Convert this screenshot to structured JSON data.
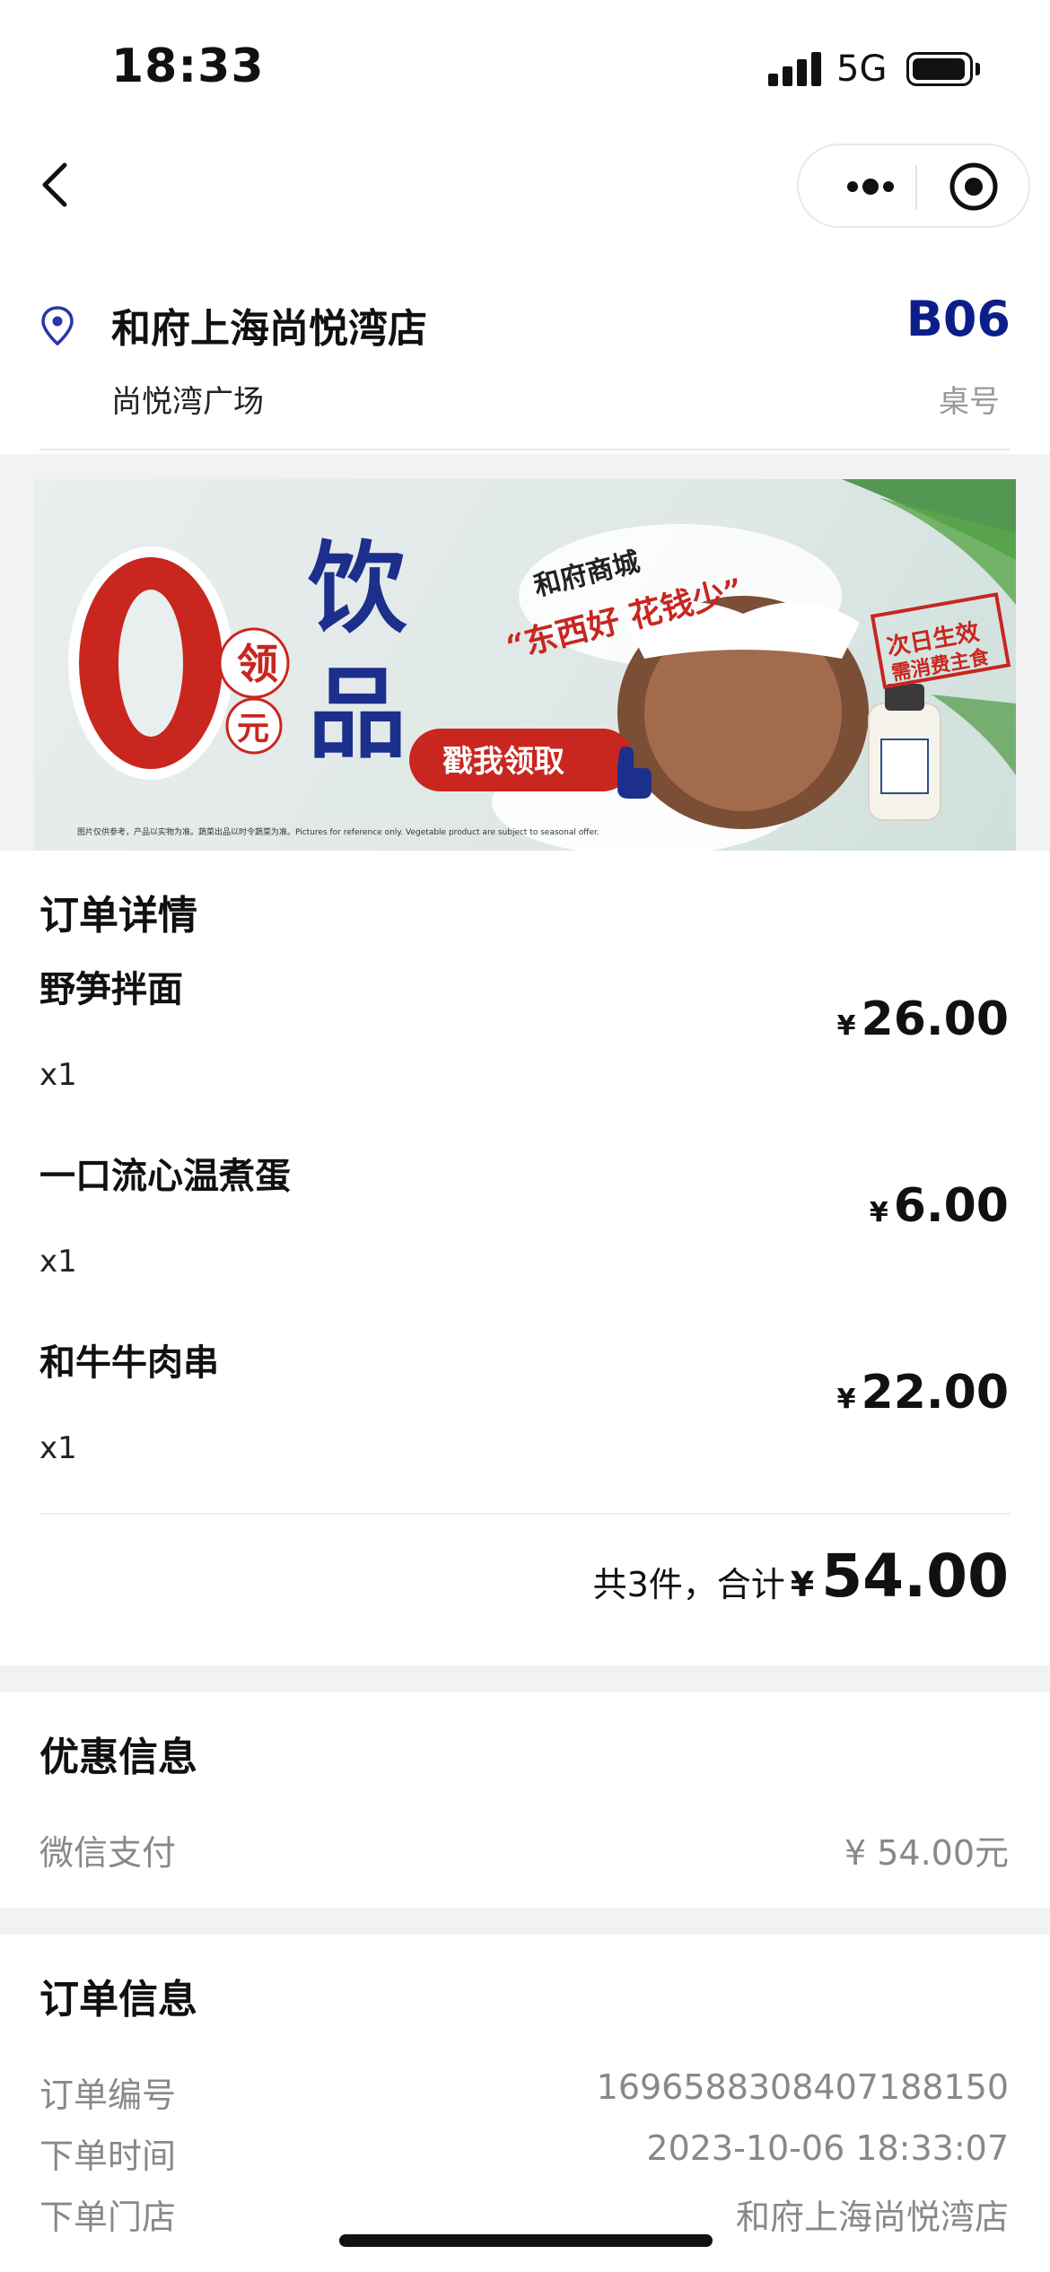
{
  "status_bar": {
    "time": "18:33",
    "network": "5G"
  },
  "store": {
    "name": "和府上海尚悦湾店",
    "location": "尚悦湾广场",
    "table_number": "B06",
    "table_label": "桌号"
  },
  "banner": {
    "big_zero": "0",
    "ling": "领",
    "yuan": "元",
    "yin": "饮",
    "pin": "品",
    "brand": "和府商城",
    "slogan": "“东西好 花钱少”",
    "button": "戳我领取",
    "stamp_line1": "次日生效",
    "stamp_line2": "需消费主食",
    "disclaimer": "图片仅供参考，产品以实物为准。蔬菜出品以时令蔬菜为准。Pictures for reference only. Vegetable product are subject to seasonal offer."
  },
  "order_details": {
    "title": "订单详情",
    "currency": "¥",
    "items": [
      {
        "name": "野笋拌面",
        "qty": "x1",
        "price": "26.00"
      },
      {
        "name": "一口流心温煮蛋",
        "qty": "x1",
        "price": "6.00"
      },
      {
        "name": "和牛牛肉串",
        "qty": "x1",
        "price": "22.00"
      }
    ],
    "summary_prefix": "共3件，合计",
    "total": "54.00"
  },
  "promo": {
    "title": "优惠信息",
    "pay_label": "微信支付",
    "pay_value": "¥ 54.00元"
  },
  "order_info": {
    "title": "订单信息",
    "rows": [
      {
        "label": "订单编号",
        "value": "1696588308407188150"
      },
      {
        "label": "下单时间",
        "value": "2023-10-06 18:33:07"
      },
      {
        "label": "下单门店",
        "value": "和府上海尚悦湾店"
      }
    ]
  },
  "colors": {
    "accent_blue": "#0b1e8a",
    "promo_red": "#c8261f",
    "promo_navy": "#1d2f8c"
  },
  "icons": [
    "back-arrow-icon",
    "more-dots-icon",
    "target-icon",
    "location-pin-icon",
    "hand-pointer-icon"
  ]
}
